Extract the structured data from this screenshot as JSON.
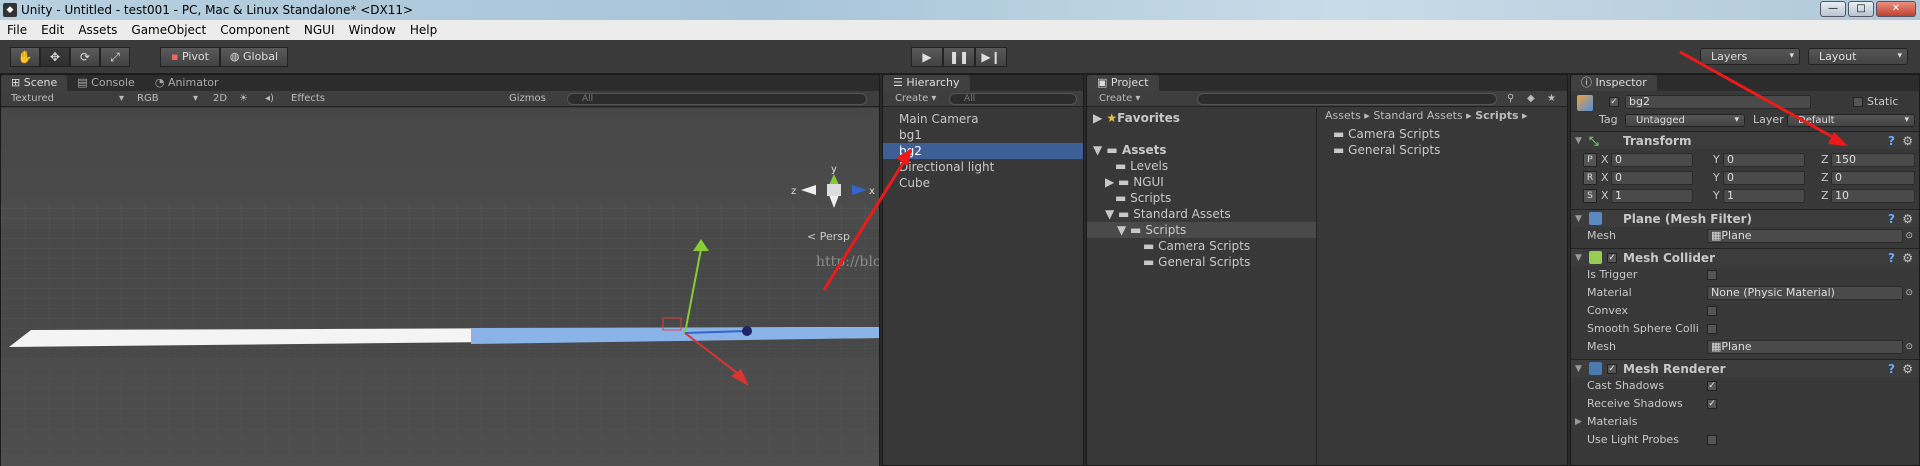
{
  "window": {
    "title": "Unity - Untitled - test001 - PC, Mac & Linux Standalone* <DX11>",
    "app_icon": "unity-icon"
  },
  "menu": [
    "File",
    "Edit",
    "Assets",
    "GameObject",
    "Component",
    "NGUI",
    "Window",
    "Help"
  ],
  "toolbar": {
    "pivot": "Pivot",
    "global": "Global",
    "layers": "Layers",
    "layout": "Layout"
  },
  "scene": {
    "tabs": [
      "Scene",
      "Console",
      "Animator"
    ],
    "render_mode": "Textured",
    "color_mode": "RGB",
    "mode_2d": "2D",
    "effects": "Effects",
    "gizmos": "Gizmos",
    "search_placeholder": "All",
    "axes": {
      "y": "y",
      "x": "x",
      "z": "z"
    },
    "persp": "Persp",
    "watermark": "http://blog.csdn.net/subsystemp"
  },
  "hierarchy": {
    "tab": "Hierarchy",
    "create": "Create",
    "search_placeholder": "All",
    "items": [
      "Main Camera",
      "bg1",
      "bg2",
      "Directional light",
      "Cube"
    ],
    "selected_index": 2
  },
  "project": {
    "tab": "Project",
    "create": "Create",
    "favorites": "Favorites",
    "assets": "Assets",
    "tree": [
      "Levels",
      "NGUI",
      "Scripts",
      "Standard Assets",
      "Scripts",
      "Camera Scripts",
      "General Scripts"
    ],
    "breadcrumb": [
      "Assets",
      "Standard Assets",
      "Scripts"
    ],
    "files": [
      "Camera Scripts",
      "General Scripts"
    ]
  },
  "inspector": {
    "tab": "Inspector",
    "object_name": "bg2",
    "static_label": "Static",
    "tag_label": "Tag",
    "tag_value": "Untagged",
    "layer_label": "Layer",
    "layer_value": "Default",
    "transform": {
      "title": "Transform",
      "rows": [
        {
          "btn": "P",
          "x": "0",
          "y": "0",
          "z": "150"
        },
        {
          "btn": "R",
          "x": "0",
          "y": "0",
          "z": "0"
        },
        {
          "btn": "S",
          "x": "1",
          "y": "1",
          "z": "10"
        }
      ]
    },
    "mesh_filter": {
      "title": "Plane (Mesh Filter)",
      "mesh_label": "Mesh",
      "mesh_value": "Plane"
    },
    "mesh_collider": {
      "title": "Mesh Collider",
      "is_trigger": "Is Trigger",
      "material": "Material",
      "material_value": "None (Physic Material)",
      "convex": "Convex",
      "smooth": "Smooth Sphere Colli",
      "mesh_label": "Mesh",
      "mesh_value": "Plane"
    },
    "mesh_renderer": {
      "title": "Mesh Renderer",
      "cast": "Cast Shadows",
      "receive": "Receive Shadows",
      "materials": "Materials",
      "light_probes": "Use Light Probes"
    }
  },
  "colors": {
    "selection": "#3e5f96",
    "panel": "#383838",
    "arrow": "#ee1a1a"
  }
}
